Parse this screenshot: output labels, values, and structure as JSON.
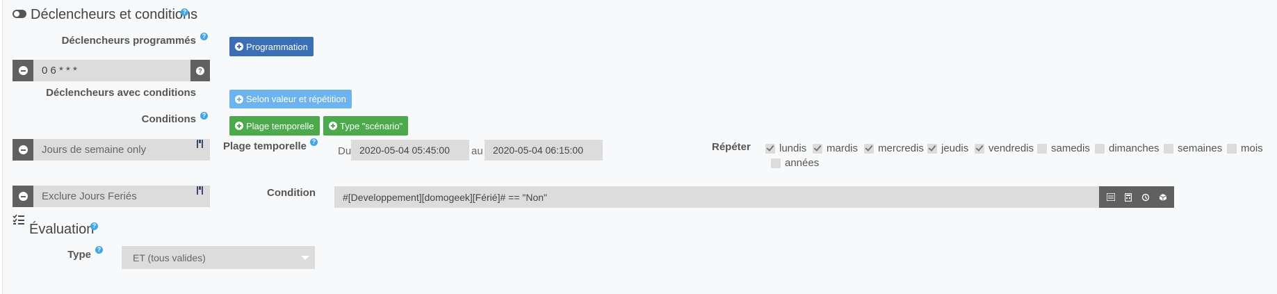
{
  "triggers_section": {
    "title": "Déclencheurs et conditions",
    "help": "?"
  },
  "scheduled": {
    "label": "Déclencheurs programmés",
    "help": "?",
    "button": "Programmation",
    "cron_value": "0 6 * * *",
    "cron_help": "?"
  },
  "conditional": {
    "label": "Déclencheurs avec conditions",
    "button": "Selon valeur et répétition"
  },
  "conditions": {
    "label": "Conditions",
    "help": "?",
    "btn_time_range": "Plage temporelle",
    "btn_scenario_type": "Type \"scénario\""
  },
  "cond1": {
    "name": "Jours de semaine only",
    "range_label": "Plage temporelle",
    "range_help": "?",
    "from_label": "Du",
    "from_value": "2020-05-04 05:45:00",
    "to_label": "au",
    "to_value": "2020-05-04 06:15:00",
    "repeat_label": "Répéter",
    "days": [
      {
        "label": "lundis",
        "checked": true
      },
      {
        "label": "mardis",
        "checked": true
      },
      {
        "label": "mercredis",
        "checked": true
      },
      {
        "label": "jeudis",
        "checked": true
      },
      {
        "label": "vendredis",
        "checked": true
      },
      {
        "label": "samedis",
        "checked": false
      },
      {
        "label": "dimanches",
        "checked": false
      },
      {
        "label": "semaines",
        "checked": false
      },
      {
        "label": "mois",
        "checked": false
      },
      {
        "label": "années",
        "checked": false
      }
    ]
  },
  "cond2": {
    "name": "Exclure Jours Feriés",
    "condition_label": "Condition",
    "expression": "#[Developpement][domogeek][Férié]# == \"Non\""
  },
  "evaluation": {
    "title": "Évaluation",
    "help": "?",
    "type_label": "Type",
    "type_help": "?",
    "type_value": "ET (tous valides)"
  },
  "colors": {
    "primary_blue": "#3a6fb3",
    "light_blue": "#6cb3ef",
    "green": "#4ca94c",
    "dark_gray": "#606060",
    "help_blue": "#41a5e7"
  }
}
